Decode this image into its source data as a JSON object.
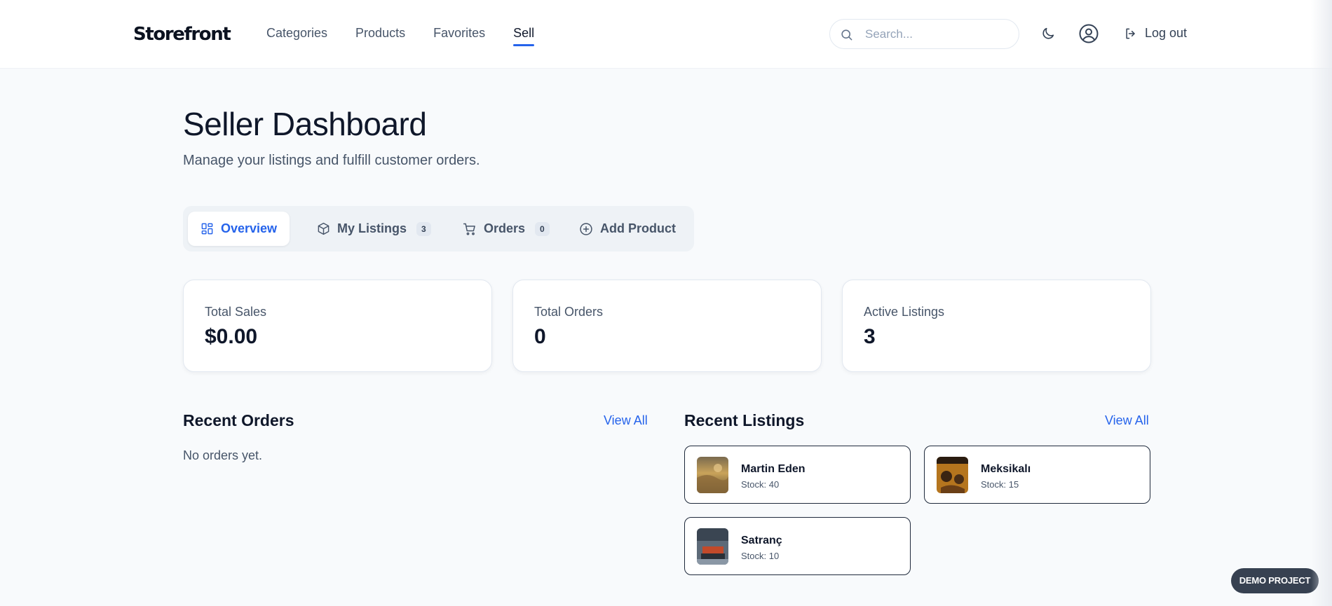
{
  "header": {
    "logo": "Storefront",
    "nav": [
      {
        "label": "Categories",
        "active": false
      },
      {
        "label": "Products",
        "active": false
      },
      {
        "label": "Favorites",
        "active": false
      },
      {
        "label": "Sell",
        "active": true
      }
    ],
    "search": {
      "placeholder": "Search...",
      "value": ""
    },
    "theme_icon": "moon-icon",
    "user_icon": "user-circle-icon",
    "logout_label": "Log out",
    "logout_icon": "log-out-icon"
  },
  "page": {
    "title": "Seller Dashboard",
    "subtitle": "Manage your listings and fulfill customer orders."
  },
  "tabs": [
    {
      "label": "Overview",
      "icon": "grid-icon",
      "active": true
    },
    {
      "label": "My Listings",
      "icon": "box-icon",
      "count": "3"
    },
    {
      "label": "Orders",
      "icon": "cart-icon",
      "count": "0"
    },
    {
      "label": "Add Product",
      "icon": "plus-circle-icon"
    }
  ],
  "stats": [
    {
      "label": "Total Sales",
      "value": "$0.00"
    },
    {
      "label": "Total Orders",
      "value": "0"
    },
    {
      "label": "Active Listings",
      "value": "3"
    }
  ],
  "recent_orders": {
    "title": "Recent Orders",
    "view_all": "View All",
    "empty": "No orders yet."
  },
  "recent_listings": {
    "title": "Recent Listings",
    "view_all": "View All",
    "items": [
      {
        "name": "Martin Eden",
        "stock": "Stock: 40"
      },
      {
        "name": "Meksikalı",
        "stock": "Stock: 15"
      },
      {
        "name": "Satranç",
        "stock": "Stock: 10"
      }
    ]
  },
  "demo_badge": "DEMO PROJECT",
  "colors": {
    "accent": "#2563eb",
    "text": "#0f172a",
    "muted": "#475569",
    "background": "#f8fafc"
  }
}
